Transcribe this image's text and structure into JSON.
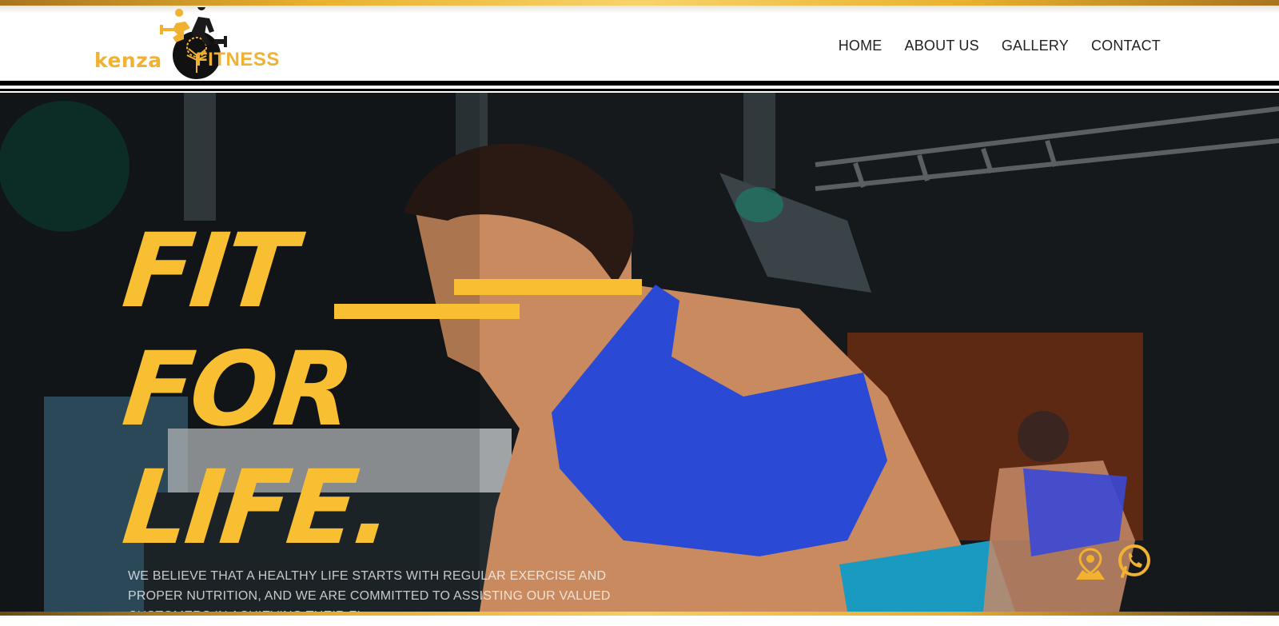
{
  "brand": {
    "name_left": "kenza",
    "name_right": "FITNESS",
    "accent": "#f1b131"
  },
  "nav": {
    "items": [
      "HOME",
      "ABOUT US",
      "GALLERY",
      "CONTACT"
    ]
  },
  "hero": {
    "headline": [
      "FIT",
      "FOR",
      "LIFE."
    ],
    "description": "WE BELIEVE THAT A HEALTHY LIFE STARTS WITH REGULAR EXERCISE AND PROPER NUTRITION, AND WE ARE COMMITTED TO ASSISTING OUR VALUED CUSTOMERS IN ACHIEVING THEIR FI",
    "headline_color": "#f8bf32"
  },
  "floating": {
    "map_icon": "map-pin-icon",
    "whatsapp_icon": "whatsapp-icon",
    "color": "#f1b131"
  }
}
